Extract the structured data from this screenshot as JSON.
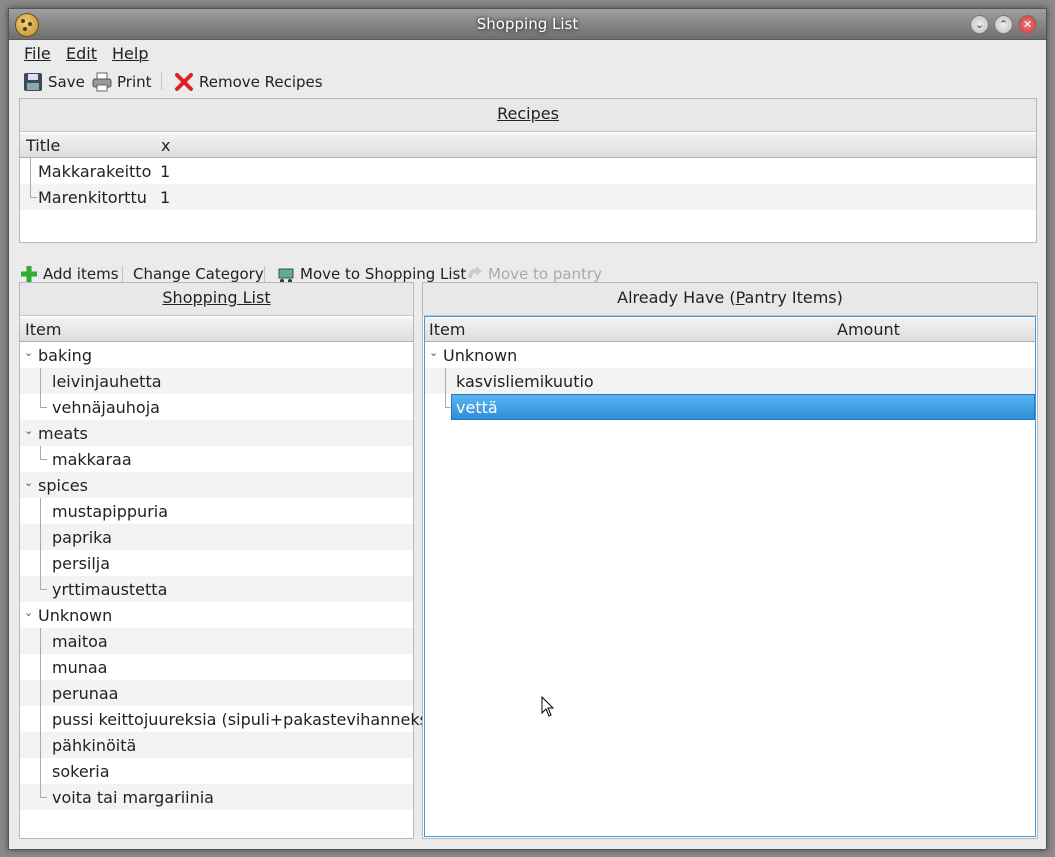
{
  "window": {
    "title": "Shopping List"
  },
  "menu": {
    "file": "File",
    "edit": "Edit",
    "help": "Help"
  },
  "toolbar": {
    "save": "Save",
    "print": "Print",
    "remove_recipes": "Remove Recipes"
  },
  "recipes": {
    "header": "Recipes",
    "columns": {
      "title": "Title",
      "x": "x"
    },
    "rows": [
      {
        "title": "Makkarakeitto",
        "x": "1"
      },
      {
        "title": "Marenkitorttu",
        "x": "1"
      }
    ]
  },
  "secondary_toolbar": {
    "add_items": "Add items",
    "change_category": "Change Category",
    "move_to_shopping_list": "Move to Shopping List",
    "move_to_pantry": "Move to pantry"
  },
  "shopping_list": {
    "header": "Shopping List",
    "column_item": "Item",
    "categories": [
      {
        "name": "baking",
        "items": [
          "leivinjauhetta",
          "vehnäjauhoja"
        ]
      },
      {
        "name": "meats",
        "items": [
          "makkaraa"
        ]
      },
      {
        "name": "spices",
        "items": [
          "mustapippuria",
          "paprika",
          "persilja",
          "yrttimaustetta"
        ]
      },
      {
        "name": "Unknown",
        "items": [
          "maitoa",
          "munaa",
          "perunaa",
          "pussi keittojuureksia (sipuli+pakastevihanneksi",
          "pähkinöitä",
          "sokeria",
          "voita tai margariinia"
        ]
      }
    ]
  },
  "pantry": {
    "header": "Already Have (Pantry Items)",
    "column_item": "Item",
    "column_amount": "Amount",
    "categories": [
      {
        "name": "Unknown",
        "items": [
          "kasvisliemikuutio",
          "vettä"
        ]
      }
    ],
    "selected_item": "vettä"
  },
  "colors": {
    "selection": "#3d9be3",
    "titlebar": "#7a7a7a"
  }
}
